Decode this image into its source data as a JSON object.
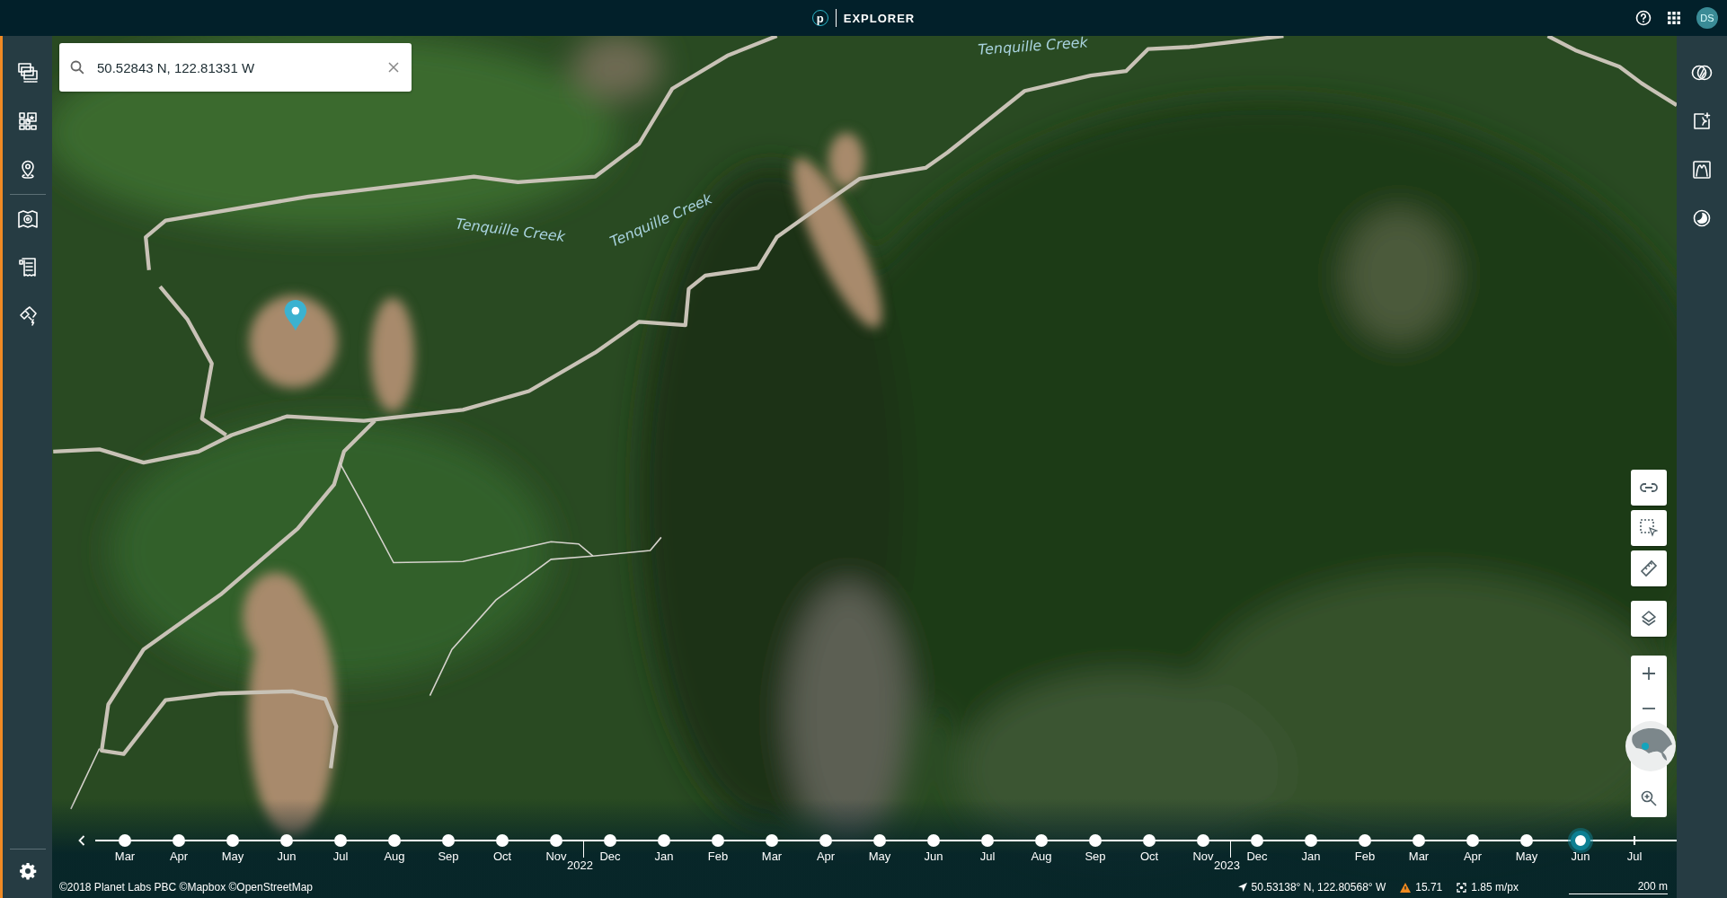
{
  "header": {
    "logo_letter": "p",
    "title": "EXPLORER",
    "avatar": "DS"
  },
  "search": {
    "value": "50.52843 N, 122.81331 W"
  },
  "map": {
    "labels": [
      "Tenquille Creek",
      "Tenquille Creek",
      "Tenquille Creek"
    ]
  },
  "timeline": {
    "items": [
      {
        "kind": "dot",
        "label": "Mar",
        "selected": false
      },
      {
        "kind": "dot",
        "label": "Apr",
        "selected": false
      },
      {
        "kind": "dot",
        "label": "May",
        "selected": false
      },
      {
        "kind": "dot",
        "label": "Jun",
        "selected": false
      },
      {
        "kind": "dot",
        "label": "Jul",
        "selected": false
      },
      {
        "kind": "dot",
        "label": "Aug",
        "selected": false
      },
      {
        "kind": "dot",
        "label": "Sep",
        "selected": false
      },
      {
        "kind": "dot",
        "label": "Oct",
        "selected": false
      },
      {
        "kind": "dot",
        "label": "Nov",
        "selected": false
      },
      {
        "kind": "year",
        "label": "2022"
      },
      {
        "kind": "dot",
        "label": "Dec",
        "selected": false
      },
      {
        "kind": "dot",
        "label": "Jan",
        "selected": false
      },
      {
        "kind": "dot",
        "label": "Feb",
        "selected": false
      },
      {
        "kind": "dot",
        "label": "Mar",
        "selected": false
      },
      {
        "kind": "dot",
        "label": "Apr",
        "selected": false
      },
      {
        "kind": "dot",
        "label": "May",
        "selected": false
      },
      {
        "kind": "dot",
        "label": "Jun",
        "selected": false
      },
      {
        "kind": "dot",
        "label": "Jul",
        "selected": false
      },
      {
        "kind": "dot",
        "label": "Aug",
        "selected": false
      },
      {
        "kind": "dot",
        "label": "Sep",
        "selected": false
      },
      {
        "kind": "dot",
        "label": "Oct",
        "selected": false
      },
      {
        "kind": "dot",
        "label": "Nov",
        "selected": false
      },
      {
        "kind": "year",
        "label": "2023"
      },
      {
        "kind": "dot",
        "label": "Dec",
        "selected": false
      },
      {
        "kind": "dot",
        "label": "Jan",
        "selected": false
      },
      {
        "kind": "dot",
        "label": "Feb",
        "selected": false
      },
      {
        "kind": "dot",
        "label": "Mar",
        "selected": false
      },
      {
        "kind": "dot",
        "label": "Apr",
        "selected": false
      },
      {
        "kind": "dot",
        "label": "May",
        "selected": false
      },
      {
        "kind": "dot",
        "label": "Jun",
        "selected": true
      },
      {
        "kind": "tick",
        "label": "Jul"
      }
    ]
  },
  "status": {
    "attribution": "©2018 Planet Labs PBC ©Mapbox ©OpenStreetMap",
    "coordinates": "50.53138° N, 122.80568° W",
    "warning_value": "15.71",
    "resolution": "1.85 m/px",
    "scale": "200 m"
  }
}
